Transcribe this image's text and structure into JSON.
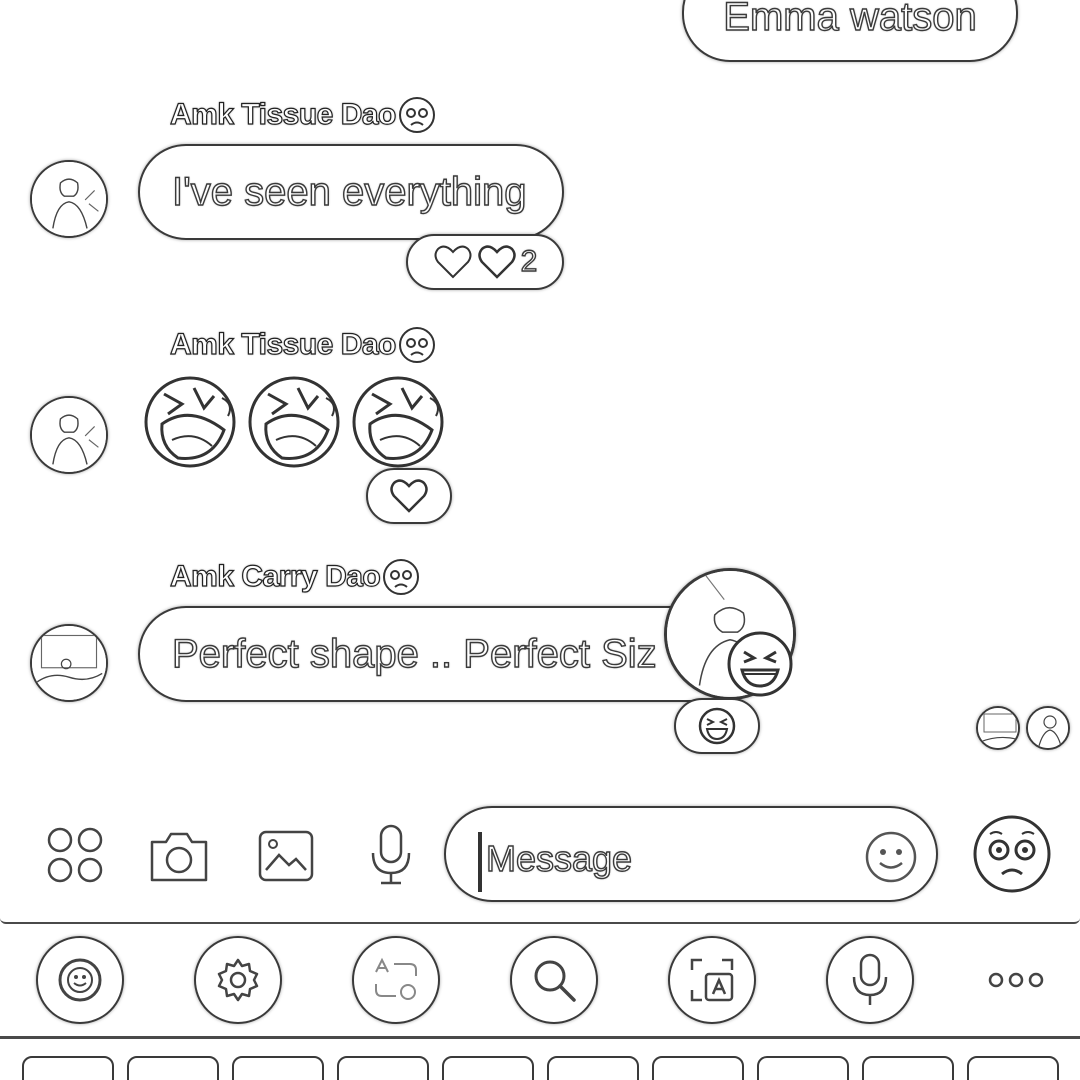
{
  "sent_message": {
    "text": "Emma watson"
  },
  "messages": [
    {
      "sender": "Amk Tissue Dao",
      "sender_emoji": "pleading-face",
      "text": "I've seen everything",
      "reactions": {
        "icons": [
          "heart",
          "heart"
        ],
        "count": "2"
      }
    },
    {
      "sender": "Amk Tissue Dao",
      "sender_emoji": "pleading-face",
      "emojis": [
        "rolling-on-floor-laughing",
        "rolling-on-floor-laughing",
        "rolling-on-floor-laughing"
      ],
      "reactions": {
        "icons": [
          "heart"
        ]
      }
    },
    {
      "sender": "Amk Carry Dao",
      "sender_emoji": "pleading-face",
      "text": "Perfect shape .. Perfect Siz",
      "reactions": {
        "icons": [
          "grinning-squinting-face"
        ]
      }
    }
  ],
  "input_bar": {
    "placeholder": "Message",
    "icons": [
      "apps-icon",
      "camera-icon",
      "gallery-icon",
      "microphone-icon",
      "emoji-icon",
      "pleading-face-icon"
    ]
  },
  "keyboard_toolbar": {
    "icons": [
      "emoji-icon",
      "settings-icon",
      "translate-icon",
      "search-icon",
      "screenshot-translate-icon",
      "microphone-icon",
      "more-icon"
    ]
  },
  "colors": {
    "stroke": "#3a3a3a",
    "background": "#ffffff"
  }
}
